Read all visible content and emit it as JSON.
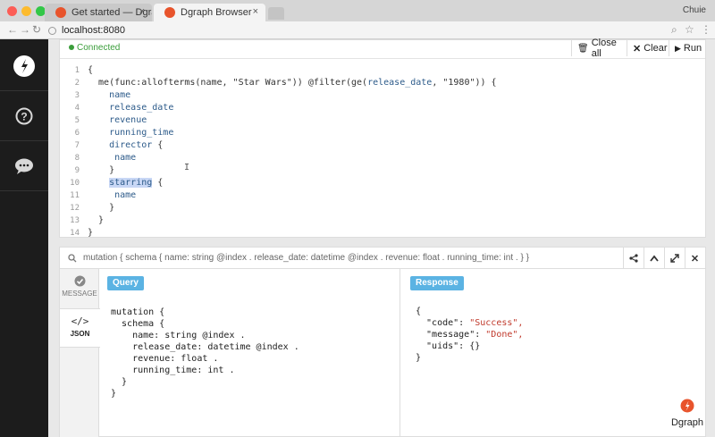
{
  "browser": {
    "tabs": [
      {
        "title": "Get started — Dgraph Doc",
        "close": "×"
      },
      {
        "title": "Dgraph Browser",
        "close": "×"
      }
    ],
    "user": "Chuie",
    "url": "localhost:8080"
  },
  "sidebar": {
    "items": [
      {
        "name": "dgraph-logo-icon"
      },
      {
        "name": "help-icon"
      },
      {
        "name": "chat-icon"
      }
    ]
  },
  "editor": {
    "status": "Connected",
    "buttons": {
      "close_all": "Close all",
      "clear": "Clear",
      "run": "Run"
    },
    "line_numbers": [
      "1",
      "2",
      "3",
      "4",
      "5",
      "6",
      "7",
      "8",
      "9",
      "10",
      "11",
      "12",
      "13",
      "14"
    ],
    "lines": [
      "{",
      "  me(func:allofterms(name, \"Star Wars\")) @filter(ge(release_date, \"1980\")) {",
      "    name",
      "    release_date",
      "    revenue",
      "    running_time",
      "    director {",
      "     name",
      "    }",
      "    starring {",
      "     name",
      "    }",
      "  }",
      "}"
    ]
  },
  "result": {
    "query_text": "mutation { schema { name: string @index . release_date: datetime @index . revenue: float . running_time: int . } }",
    "view_tabs": [
      {
        "label": "MESSAGE"
      },
      {
        "label": "JSON"
      }
    ],
    "query_label": "Query",
    "response_label": "Response",
    "query_lines": [
      "mutation {",
      "  schema {",
      "    name: string @index .",
      "    release_date: datetime @index .",
      "    revenue: float .",
      "    running_time: int .",
      "  }",
      "}"
    ],
    "response_lines": [
      "{",
      "  \"code\": ",
      "  \"message\": ",
      "  \"uids\": {}",
      "}"
    ],
    "response_values": {
      "code": "\"Success\",",
      "message": "\"Done\","
    }
  },
  "brand": "Dgraph",
  "colors": {
    "accent": "#5bb3e3",
    "connected": "#3a9d3a",
    "sidebar": "#1c1c1c",
    "logo": "#e8542c"
  }
}
